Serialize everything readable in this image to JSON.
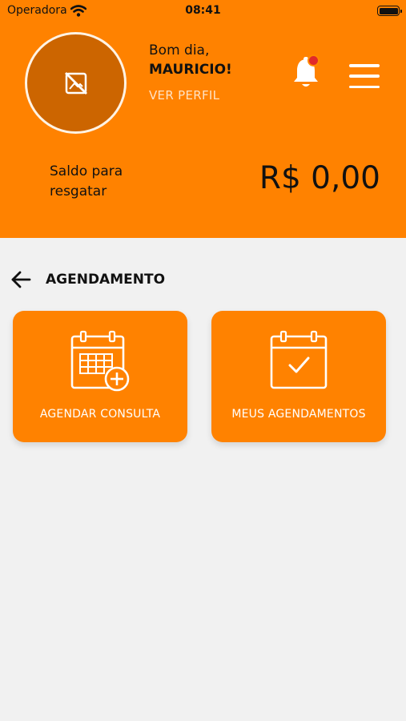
{
  "status_bar": {
    "carrier": "Operadora",
    "time": "08:41"
  },
  "profile": {
    "greeting": "Bom dia,",
    "name": "MAURICIO!",
    "view_profile": "VER PERFIL"
  },
  "balance": {
    "label": "Saldo para resgatar",
    "value": "R$ 0,00"
  },
  "section": {
    "title": "AGENDAMENTO"
  },
  "cards": [
    {
      "label": "AGENDAR CONSULTA",
      "icon": "calendar-plus-icon"
    },
    {
      "label": "MEUS AGENDAMENTOS",
      "icon": "calendar-check-icon"
    }
  ],
  "colors": {
    "primary": "#ff8200",
    "avatar_bg": "#cc6500",
    "background": "#f1f1f1",
    "notification_dot": "#e12a2a"
  }
}
